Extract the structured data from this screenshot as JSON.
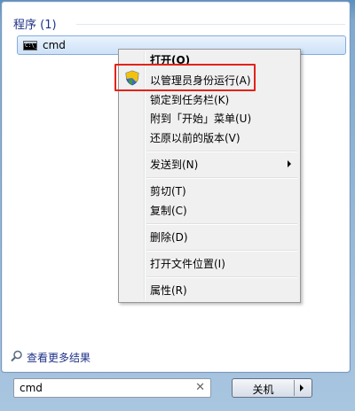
{
  "results": {
    "section_title": "程序 (1)",
    "items": [
      {
        "label": "cmd",
        "icon": "cmd-console-icon"
      }
    ]
  },
  "context_menu": {
    "items": [
      {
        "label": "打开(O)",
        "bold": true
      },
      {
        "label": "以管理员身份运行(A)",
        "icon": "uac-shield-icon",
        "highlighted": true
      },
      {
        "label": "锁定到任务栏(K)"
      },
      {
        "label": "附到「开始」菜单(U)"
      },
      {
        "label": "还原以前的版本(V)"
      },
      {
        "label": "发送到(N)",
        "submenu": true
      },
      {
        "label": "剪切(T)"
      },
      {
        "label": "复制(C)"
      },
      {
        "label": "删除(D)"
      },
      {
        "label": "打开文件位置(I)"
      },
      {
        "label": "属性(R)"
      }
    ]
  },
  "see_more": {
    "label": "查看更多结果",
    "icon": "search-icon"
  },
  "search": {
    "value": "cmd",
    "clear_icon": "close-icon"
  },
  "shutdown": {
    "label": "关机",
    "arrow_icon": "arrow-right-icon"
  },
  "colors": {
    "highlight_border": "#e2231a",
    "section_title": "#1e3287",
    "link": "#1e3287"
  }
}
